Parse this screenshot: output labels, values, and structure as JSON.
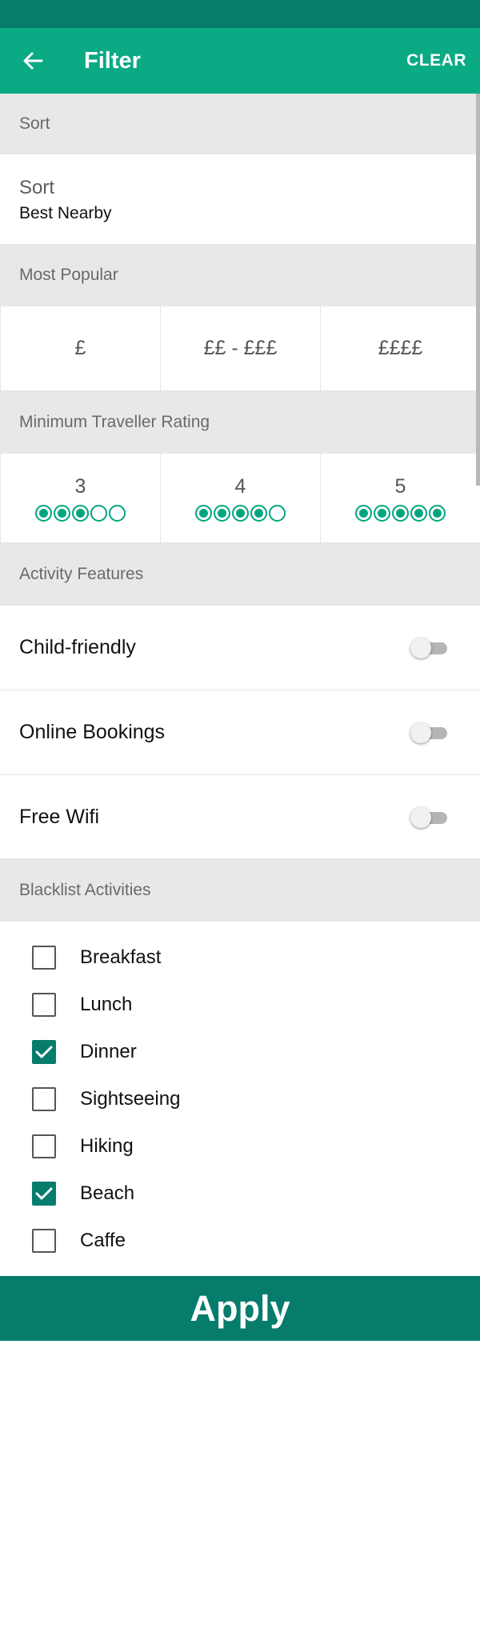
{
  "app_bar": {
    "title": "Filter",
    "clear_label": "CLEAR",
    "back_icon": "arrow-left-icon"
  },
  "colors": {
    "status_bar": "#067c6c",
    "app_bar": "#0aaa84",
    "accent": "#00a680",
    "apply": "#067c6c"
  },
  "sort_section": {
    "header": "Sort",
    "label": "Sort",
    "value": "Best Nearby"
  },
  "popular_section": {
    "header": "Most Popular",
    "options": [
      "£",
      "££ - £££",
      "££££"
    ]
  },
  "rating_section": {
    "header": "Minimum Traveller Rating",
    "options": [
      {
        "value": "3",
        "filled": 3,
        "max": 5
      },
      {
        "value": "4",
        "filled": 4,
        "max": 5
      },
      {
        "value": "5",
        "filled": 5,
        "max": 5
      }
    ]
  },
  "features_section": {
    "header": "Activity Features",
    "items": [
      {
        "label": "Child-friendly",
        "on": false
      },
      {
        "label": "Online Bookings",
        "on": false
      },
      {
        "label": "Free Wifi",
        "on": false
      }
    ]
  },
  "blacklist_section": {
    "header": "Blacklist Activities",
    "items": [
      {
        "label": "Breakfast",
        "checked": false
      },
      {
        "label": "Lunch",
        "checked": false
      },
      {
        "label": "Dinner",
        "checked": true
      },
      {
        "label": "Sightseeing",
        "checked": false
      },
      {
        "label": "Hiking",
        "checked": false
      },
      {
        "label": "Beach",
        "checked": true
      },
      {
        "label": "Caffe",
        "checked": false
      }
    ]
  },
  "apply_label": "Apply"
}
